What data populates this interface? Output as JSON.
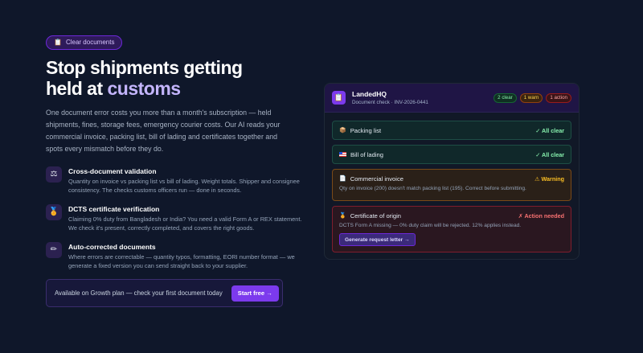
{
  "hero": {
    "pill_icon": "clipboard-icon",
    "pill_label": "Clear documents",
    "title_line1": "Stop shipments getting",
    "title_line2_prefix": "held at ",
    "title_accent": "customs",
    "intro": "One document error costs you more than a month's subscription — held shipments, fines, storage fees, emergency courier costs. Our AI reads your commercial invoice, packing list, bill of lading and certificates together and spots every mismatch before they do."
  },
  "features": [
    {
      "icon": "scale-icon",
      "glyph": "⚖",
      "title": "Cross-document validation",
      "desc": "Quantity on invoice vs packing list vs bill of lading. Weight totals. Shipper and consignee consistency. The checks customs officers run — done in seconds."
    },
    {
      "icon": "medal-icon",
      "glyph": "🏅",
      "title": "DCTS certificate verification",
      "desc": "Claiming 0% duty from Bangladesh or India? You need a valid Form A or REX statement. We check it's present, correctly completed, and covers the right goods."
    },
    {
      "icon": "pencil-icon",
      "glyph": "✏",
      "title": "Auto-corrected documents",
      "desc": "Where errors are correctable — quantity typos, formatting, EORI number format — we generate a fixed version you can send straight back to your supplier."
    }
  ],
  "cta": {
    "text": "Available on Growth plan — check your first document today",
    "button": "Start free →"
  },
  "card": {
    "brand": "LandedHQ",
    "subtitle": "Document check · INV-2026-0441",
    "badges": {
      "clear": "2 clear",
      "warn": "1 warn",
      "action": "1 action"
    },
    "rows": [
      {
        "icon": "box-icon",
        "glyph": "📦",
        "label": "Packing list",
        "status": "✓ All clear"
      },
      {
        "icon": "flag-icon",
        "glyph": "🇺🇸",
        "label": "Bill of lading",
        "status": "✓ All clear"
      },
      {
        "icon": "document-icon",
        "glyph": "📄",
        "label": "Commercial invoice",
        "status": "⚠ Warning",
        "note": "Qty on invoice (200) doesn't match packing list (195). Correct before submitting."
      },
      {
        "icon": "medal-icon",
        "glyph": "🏅",
        "label": "Certificate of origin",
        "status": "✗ Action needed",
        "note": "DCTS Form A missing — 0% duty claim will be rejected. 12% applies instead.",
        "button": "Generate request letter →"
      }
    ]
  },
  "colors": {
    "background": "#0f172a",
    "accent": "#7c3aed",
    "accent_text": "#c4b5fd",
    "ok": "#86efac",
    "warn": "#fbbf24",
    "error": "#f87171"
  }
}
